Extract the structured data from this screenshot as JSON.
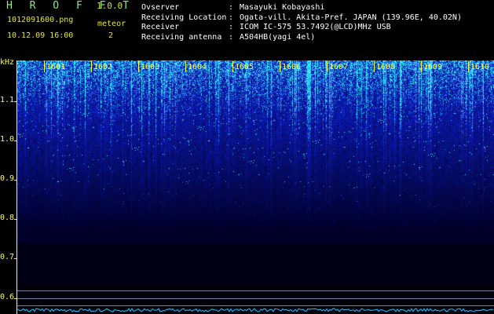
{
  "header": {
    "app_title": "H R O F F T",
    "app_version": "1.0.0",
    "filename": "1012091600.png",
    "timestamp": "10.12.09 16:00",
    "meteor_label": "meteor",
    "meteor_count": "2",
    "info": [
      {
        "key": "Ovserver",
        "value": "Masayuki Kobayashi"
      },
      {
        "key": "Receiving Location",
        "value": "Ogata-vill. Akita-Pref. JAPAN (139.96E, 40.02N)"
      },
      {
        "key": "Receiver",
        "value": "ICOM IC-575 53.7492(@LCD)MHz USB"
      },
      {
        "key": "Receiving antenna",
        "value": "A504HB(yagi 4el)"
      }
    ]
  },
  "axes": {
    "y_unit": "kHz",
    "y_ticks": [
      "1.1",
      "1.0",
      "0.9",
      "0.8",
      "0.7",
      "0.6"
    ],
    "x_ticks": [
      "1601",
      "1602",
      "1603",
      "1604",
      "1605",
      "1606",
      "1607",
      "1608",
      "1609",
      "1610"
    ]
  },
  "colors": {
    "axis": "#ffff4a",
    "spectrum_bright": "#1ec8ff",
    "spectrum_mid": "#1f3cd6",
    "spectrum_dark": "#070a3a"
  }
}
